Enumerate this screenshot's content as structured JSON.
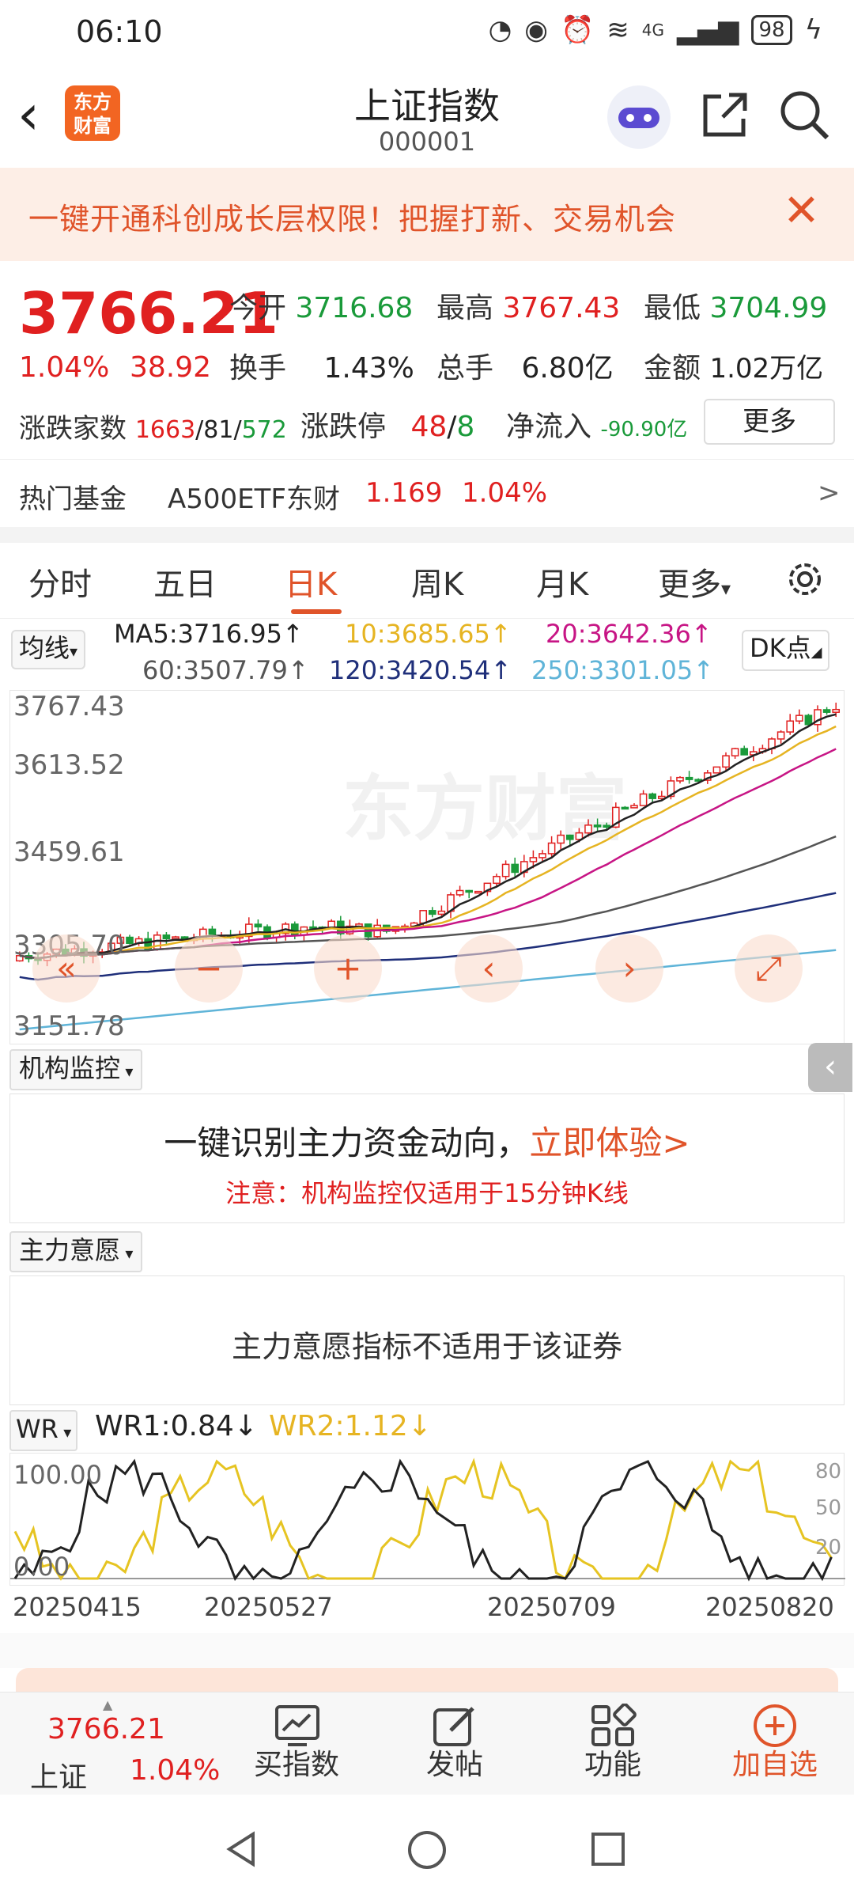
{
  "status": {
    "time": "06:10",
    "network": "4G",
    "battery": "98"
  },
  "header": {
    "title": "上证指数",
    "code": "000001",
    "logo_text": "东方财富"
  },
  "banner": {
    "text": "一键开通科创成长层权限！把握打新、交易机会"
  },
  "quote": {
    "price": "3766.21",
    "change_pct": "1.04%",
    "change_val": "38.92",
    "open_label": "今开",
    "open": "3716.68",
    "high_label": "最高",
    "high": "3767.43",
    "low_label": "最低",
    "low": "3704.99",
    "turnover_label": "换手",
    "turnover": "1.43%",
    "volume_label": "总手",
    "volume": "6.80亿",
    "amount_label": "金额",
    "amount": "1.02万亿",
    "breadth_label": "涨跌家数",
    "up": "1663",
    "flat": "81",
    "down": "572",
    "limit_label": "涨跌停",
    "limit_up": "48",
    "limit_down": "8",
    "netflow_label": "净流入",
    "netflow": "-90.90亿",
    "more_label": "更多"
  },
  "hot_fund": {
    "label": "热门基金",
    "name": "A500ETF东财",
    "price": "1.169",
    "pct": "1.04%",
    "arrow": ">"
  },
  "tabs": [
    "分时",
    "五日",
    "日K",
    "周K",
    "月K",
    "更多"
  ],
  "active_tab": "日K",
  "ma_legend": {
    "selector": "均线",
    "ma5": "MA5:3716.95↑",
    "ma10": "10:3685.65↑",
    "ma20": "20:3642.36↑",
    "ma60": "60:3507.79↑",
    "ma120": "120:3420.54↑",
    "ma250": "250:3301.05↑",
    "dk_label": "DK点",
    "colors": {
      "ma5": "#222222",
      "ma10": "#e6b422",
      "ma20": "#c71585",
      "ma60": "#555555",
      "ma120": "#1f2f7a",
      "ma250": "#5fb4d8"
    }
  },
  "kline": {
    "y_labels": [
      "3767.43",
      "3613.52",
      "3459.61",
      "3305.70",
      "3151.78"
    ],
    "watermark": "东方财富"
  },
  "inst_monitor": {
    "selector": "机构监控",
    "headline": "一键识别主力资金动向，",
    "cta": "立即体验>",
    "note": "注意：机构监控仅适用于15分钟K线"
  },
  "main_will": {
    "selector": "主力意愿",
    "message": "主力意愿指标不适用于该证券"
  },
  "wr": {
    "selector": "WR",
    "wr1": "WR1:0.84↓",
    "wr2": "WR2:1.12↓",
    "y_left": [
      "100.00",
      "0.00"
    ],
    "y_right": [
      "80",
      "50",
      "20"
    ],
    "dates": [
      "20250415",
      "20250527",
      "20250709",
      "20250820"
    ]
  },
  "bottom_nav": {
    "index_price": "3766.21",
    "index_name": "上证",
    "index_pct": "1.04%",
    "items": [
      "买指数",
      "发帖",
      "功能",
      "加自选"
    ]
  }
}
